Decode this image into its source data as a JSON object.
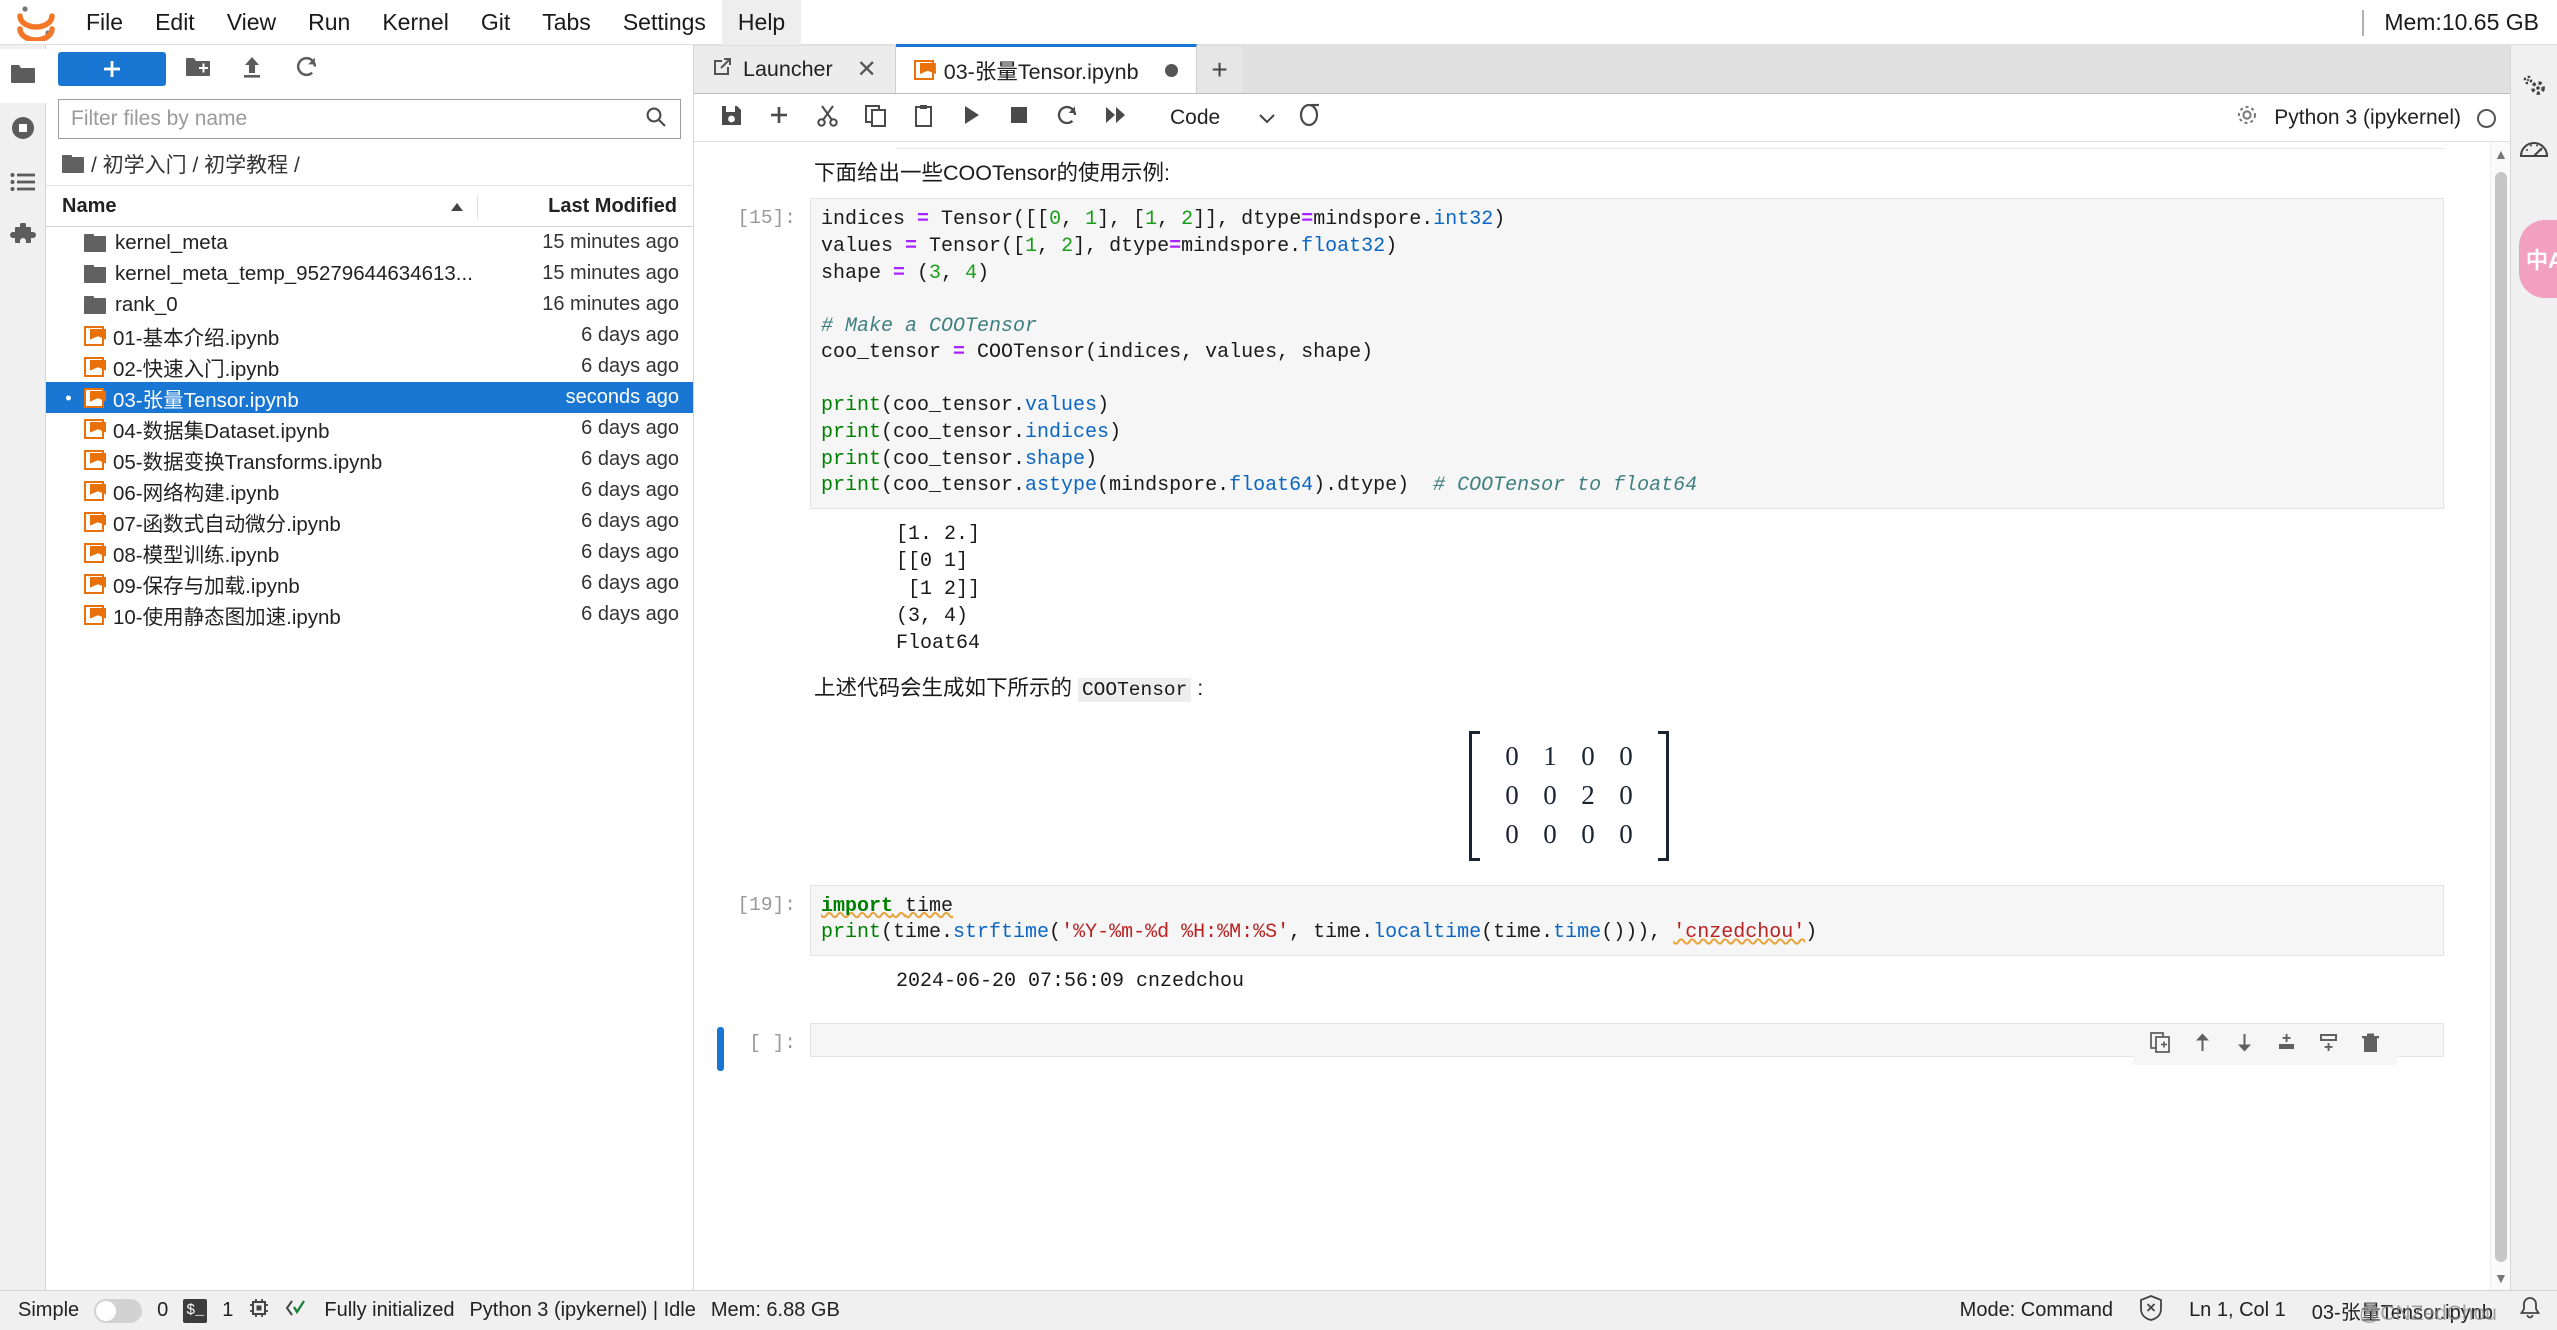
{
  "menubar": {
    "items": [
      "File",
      "Edit",
      "View",
      "Run",
      "Kernel",
      "Git",
      "Tabs",
      "Settings",
      "Help"
    ],
    "highlighted": "Help",
    "memory": "Mem:10.65 GB",
    "logo_icon": "jupyter-logo-icon"
  },
  "activity_bar": {
    "items": [
      {
        "name": "file-browser",
        "icon": "folder-icon",
        "active": true
      },
      {
        "name": "running-sessions",
        "icon": "stop-circle-icon",
        "active": false
      },
      {
        "name": "commands",
        "icon": "list-icon",
        "active": false
      },
      {
        "name": "extensions",
        "icon": "puzzle-icon",
        "active": false
      }
    ]
  },
  "filebrowser": {
    "new_launcher_label": "+",
    "toolbar_icons": [
      "new-folder-icon",
      "upload-icon",
      "refresh-icon"
    ],
    "filter": {
      "placeholder": "Filter files by name",
      "value": "",
      "icon": "search-icon"
    },
    "breadcrumb": {
      "root_icon": "folder-icon",
      "path": "/ 初学入门 / 初学教程 /"
    },
    "columns": {
      "name": "Name",
      "last_modified": "Last Modified",
      "sort_icon": "caret-up-icon"
    },
    "rows": [
      {
        "name": "kernel_meta",
        "modified": "15 minutes ago",
        "type": "folder",
        "selected": false
      },
      {
        "name": "kernel_meta_temp_95279644634613...",
        "modified": "15 minutes ago",
        "type": "folder",
        "selected": false
      },
      {
        "name": "rank_0",
        "modified": "16 minutes ago",
        "type": "folder",
        "selected": false
      },
      {
        "name": "01-基本介绍.ipynb",
        "modified": "6 days ago",
        "type": "notebook",
        "selected": false
      },
      {
        "name": "02-快速入门.ipynb",
        "modified": "6 days ago",
        "type": "notebook",
        "selected": false
      },
      {
        "name": "03-张量Tensor.ipynb",
        "modified": "seconds ago",
        "type": "notebook",
        "selected": true
      },
      {
        "name": "04-数据集Dataset.ipynb",
        "modified": "6 days ago",
        "type": "notebook",
        "selected": false
      },
      {
        "name": "05-数据变换Transforms.ipynb",
        "modified": "6 days ago",
        "type": "notebook",
        "selected": false
      },
      {
        "name": "06-网络构建.ipynb",
        "modified": "6 days ago",
        "type": "notebook",
        "selected": false
      },
      {
        "name": "07-函数式自动微分.ipynb",
        "modified": "6 days ago",
        "type": "notebook",
        "selected": false
      },
      {
        "name": "08-模型训练.ipynb",
        "modified": "6 days ago",
        "type": "notebook",
        "selected": false
      },
      {
        "name": "09-保存与加载.ipynb",
        "modified": "6 days ago",
        "type": "notebook",
        "selected": false
      },
      {
        "name": "10-使用静态图加速.ipynb",
        "modified": "6 days ago",
        "type": "notebook",
        "selected": false
      }
    ]
  },
  "tabs": [
    {
      "label": "Launcher",
      "icon": "launcher-icon",
      "active": false,
      "closable": true
    },
    {
      "label": "03-张量Tensor.ipynb",
      "icon": "notebook-icon",
      "active": true,
      "dirty": true
    }
  ],
  "tab_add_label": "+",
  "notebook_toolbar": {
    "buttons": [
      "save-icon",
      "insert-cell-icon",
      "cut-icon",
      "copy-icon",
      "paste-icon",
      "run-icon",
      "stop-icon",
      "restart-icon",
      "restart-run-all-icon"
    ],
    "cell_type": "Code",
    "cell_type_caret": "chevron-down-icon",
    "restart_kernel_icon": "restart-kernel-icon",
    "kernel_name": "Python 3 (ipykernel)",
    "kernel_status_icon": "kernel-idle-circle-icon",
    "settings_icon": "gear-icon"
  },
  "notebook": {
    "markdown_intro": "下面给出一些COOTensor的使用示例:",
    "cell1": {
      "prompt": "[15]:",
      "lines": [
        [
          {
            "t": "indices ",
            "c": ""
          },
          {
            "t": "=",
            "c": "s-op"
          },
          {
            "t": " Tensor([[",
            "c": ""
          },
          {
            "t": "0",
            "c": "s-num"
          },
          {
            "t": ", ",
            "c": ""
          },
          {
            "t": "1",
            "c": "s-num"
          },
          {
            "t": "], [",
            "c": ""
          },
          {
            "t": "1",
            "c": "s-num"
          },
          {
            "t": ", ",
            "c": ""
          },
          {
            "t": "2",
            "c": "s-num"
          },
          {
            "t": "]], dtype",
            "c": ""
          },
          {
            "t": "=",
            "c": "s-op"
          },
          {
            "t": "mindspore.",
            "c": ""
          },
          {
            "t": "int32",
            "c": "s-attr"
          },
          {
            "t": ")",
            "c": ""
          }
        ],
        [
          {
            "t": "values ",
            "c": ""
          },
          {
            "t": "=",
            "c": "s-op"
          },
          {
            "t": " Tensor([",
            "c": ""
          },
          {
            "t": "1",
            "c": "s-num"
          },
          {
            "t": ", ",
            "c": ""
          },
          {
            "t": "2",
            "c": "s-num"
          },
          {
            "t": "], dtype",
            "c": ""
          },
          {
            "t": "=",
            "c": "s-op"
          },
          {
            "t": "mindspore.",
            "c": ""
          },
          {
            "t": "float32",
            "c": "s-attr"
          },
          {
            "t": ")",
            "c": ""
          }
        ],
        [
          {
            "t": "shape ",
            "c": ""
          },
          {
            "t": "=",
            "c": "s-op"
          },
          {
            "t": " (",
            "c": ""
          },
          {
            "t": "3",
            "c": "s-num"
          },
          {
            "t": ", ",
            "c": ""
          },
          {
            "t": "4",
            "c": "s-num"
          },
          {
            "t": ")",
            "c": ""
          }
        ],
        [
          {
            "t": "",
            "c": ""
          }
        ],
        [
          {
            "t": "# Make a COOTensor",
            "c": "s-com"
          }
        ],
        [
          {
            "t": "coo_tensor ",
            "c": ""
          },
          {
            "t": "=",
            "c": "s-op"
          },
          {
            "t": " COOTensor(indices, values, shape)",
            "c": ""
          }
        ],
        [
          {
            "t": "",
            "c": ""
          }
        ],
        [
          {
            "t": "print",
            "c": "s-bi"
          },
          {
            "t": "(coo_tensor.",
            "c": ""
          },
          {
            "t": "values",
            "c": "s-attr"
          },
          {
            "t": ")",
            "c": ""
          }
        ],
        [
          {
            "t": "print",
            "c": "s-bi"
          },
          {
            "t": "(coo_tensor.",
            "c": ""
          },
          {
            "t": "indices",
            "c": "s-attr"
          },
          {
            "t": ")",
            "c": ""
          }
        ],
        [
          {
            "t": "print",
            "c": "s-bi"
          },
          {
            "t": "(coo_tensor.",
            "c": ""
          },
          {
            "t": "shape",
            "c": "s-attr"
          },
          {
            "t": ")",
            "c": ""
          }
        ],
        [
          {
            "t": "print",
            "c": "s-bi"
          },
          {
            "t": "(coo_tensor.",
            "c": ""
          },
          {
            "t": "astype",
            "c": "s-attr"
          },
          {
            "t": "(mindspore.",
            "c": ""
          },
          {
            "t": "float64",
            "c": "s-attr"
          },
          {
            "t": ").dtype)  ",
            "c": ""
          },
          {
            "t": "# COOTensor to float64",
            "c": "s-com"
          }
        ]
      ],
      "output": "[1. 2.]\n[[0 1]\n [1 2]]\n(3, 4)\nFloat64"
    },
    "markdown_after": {
      "pre": "上述代码会生成如下所示的 ",
      "code": "COOTensor",
      "post": " :"
    },
    "matrix": {
      "rows": [
        [
          "0",
          "1",
          "0",
          "0"
        ],
        [
          "0",
          "0",
          "2",
          "0"
        ],
        [
          "0",
          "0",
          "0",
          "0"
        ]
      ]
    },
    "cell2": {
      "prompt": "[19]:",
      "lines": [
        [
          {
            "t": "import",
            "c": "s-kw s-err"
          },
          {
            "t": " ",
            "c": "s-err"
          },
          {
            "t": "time",
            "c": "s-err"
          }
        ],
        [
          {
            "t": "print",
            "c": "s-bi"
          },
          {
            "t": "(time.",
            "c": ""
          },
          {
            "t": "strftime",
            "c": "s-attr"
          },
          {
            "t": "(",
            "c": ""
          },
          {
            "t": "'%Y-%m-%d %H:%M:%S'",
            "c": "s-str"
          },
          {
            "t": ", time.",
            "c": ""
          },
          {
            "t": "localtime",
            "c": "s-attr"
          },
          {
            "t": "(time.",
            "c": ""
          },
          {
            "t": "time",
            "c": "s-attr"
          },
          {
            "t": "())), ",
            "c": ""
          },
          {
            "t": "'cnzedchou'",
            "c": "s-str s-err"
          },
          {
            "t": ")",
            "c": ""
          }
        ]
      ],
      "output": "2024-06-20 07:56:09 cnzedchou"
    },
    "cell3": {
      "prompt": "[ ]:",
      "value": "",
      "selected": true,
      "toolbar_icons": [
        "duplicate-cell-icon",
        "move-cell-up-icon",
        "move-cell-down-icon",
        "insert-cell-above-icon",
        "insert-cell-below-icon",
        "delete-cell-icon"
      ]
    }
  },
  "right_bar": {
    "items": [
      {
        "name": "property-inspector",
        "icon": "gears-icon"
      },
      {
        "name": "debugger",
        "icon": "gauge-icon"
      }
    ],
    "translate_widget": {
      "icon": "translate-icon",
      "label": "中A"
    }
  },
  "statusbar": {
    "simple_label": "Simple",
    "simple_on": false,
    "kernels_count": "0",
    "terminal_badge": "$_",
    "terminals_count": "1",
    "cpu_icon": "cpu-icon",
    "init_icon": "check-code-icon",
    "init_text": "Fully initialized",
    "kernel_text": "Python 3 (ipykernel) | Idle",
    "memory": "Mem: 6.88 GB",
    "mode": "Mode: Command",
    "no_connection_icon": "shield-x-icon",
    "position": "Ln 1, Col 1",
    "filename": "03-张量Tensor.ipynb",
    "bell_icon": "bell-icon",
    "watermark": "@CNZedChou"
  },
  "colors": {
    "accent": "#1976d2",
    "notebook_orange": "#e8710a",
    "translate_pink": "#f2a0c0",
    "cell_bg": "#f6f6f6"
  }
}
